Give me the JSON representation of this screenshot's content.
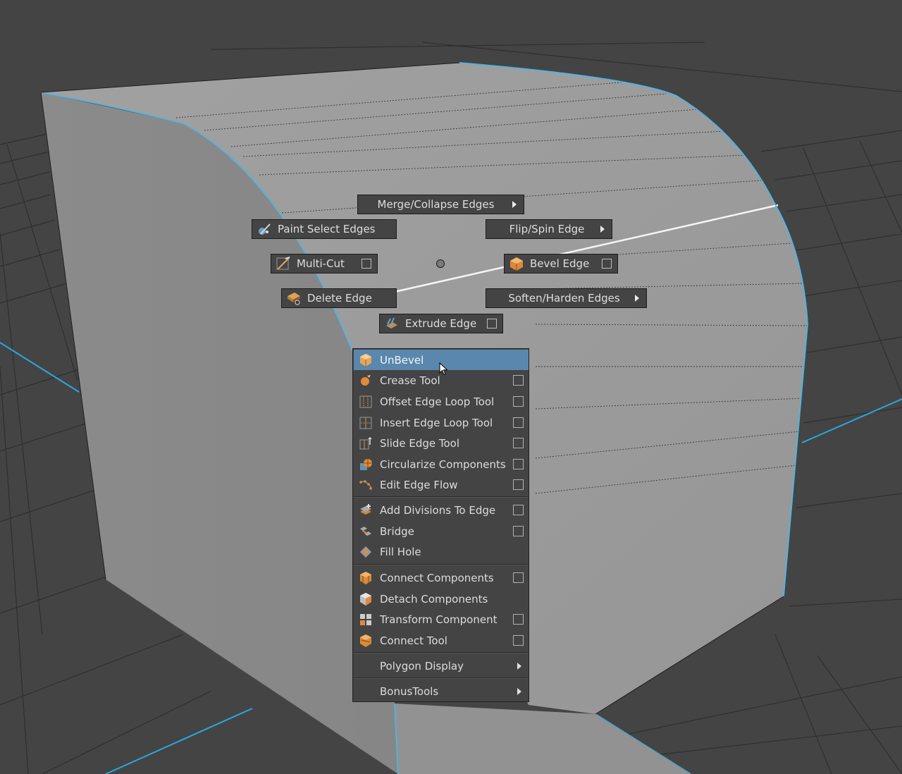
{
  "colors": {
    "background": "#444444",
    "grid_line": "#2e2e2e",
    "axis_blue": "#29a8e0",
    "mesh_surface": "#9a9a9a",
    "menu_bg": "#444444",
    "highlight": "#5a87ad"
  },
  "marking_menu": {
    "north": {
      "label": "Merge/Collapse Edges",
      "submenu": true
    },
    "north_west": {
      "label": "Paint Select Edges",
      "icon": "paint-select-icon"
    },
    "north_east": {
      "label": "Flip/Spin Edge",
      "submenu": true
    },
    "west": {
      "label": "Multi-Cut",
      "icon": "multi-cut-icon",
      "option_box": true
    },
    "east": {
      "label": "Bevel Edge",
      "icon": "bevel-icon",
      "option_box": true
    },
    "south_west": {
      "label": "Delete Edge",
      "icon": "delete-edge-icon"
    },
    "south_east": {
      "label": "Soften/Harden Edges",
      "submenu": true
    },
    "south": {
      "label": "Extrude Edge",
      "icon": "extrude-edge-icon",
      "option_box": true
    }
  },
  "context_menu": {
    "items": [
      {
        "label": "UnBevel",
        "icon": "unbevel-icon",
        "highlighted": true
      },
      {
        "label": "Crease Tool",
        "icon": "crease-icon",
        "option_box": true
      },
      {
        "label": "Offset Edge Loop Tool",
        "icon": "offset-edge-loop-icon",
        "option_box": true
      },
      {
        "label": "Insert Edge Loop Tool",
        "icon": "insert-edge-loop-icon",
        "option_box": true
      },
      {
        "label": "Slide Edge Tool",
        "icon": "slide-edge-icon",
        "option_box": true
      },
      {
        "label": "Circularize Components",
        "icon": "circularize-icon",
        "option_box": true
      },
      {
        "label": "Edit Edge Flow",
        "icon": "edit-edge-flow-icon",
        "option_box": true
      },
      {
        "label": "Add Divisions To Edge",
        "icon": "add-divisions-icon",
        "option_box": true
      },
      {
        "label": "Bridge",
        "icon": "bridge-icon",
        "option_box": true
      },
      {
        "label": "Fill Hole",
        "icon": "fill-hole-icon"
      },
      {
        "label": "Connect Components",
        "icon": "connect-components-icon",
        "option_box": true
      },
      {
        "label": "Detach Components",
        "icon": "detach-components-icon"
      },
      {
        "label": "Transform Component",
        "icon": "transform-component-icon",
        "option_box": true
      },
      {
        "label": "Connect Tool",
        "icon": "connect-tool-icon",
        "option_box": true
      },
      {
        "label": "Polygon Display",
        "submenu": true
      },
      {
        "label": "BonusTools",
        "submenu": true
      }
    ]
  }
}
